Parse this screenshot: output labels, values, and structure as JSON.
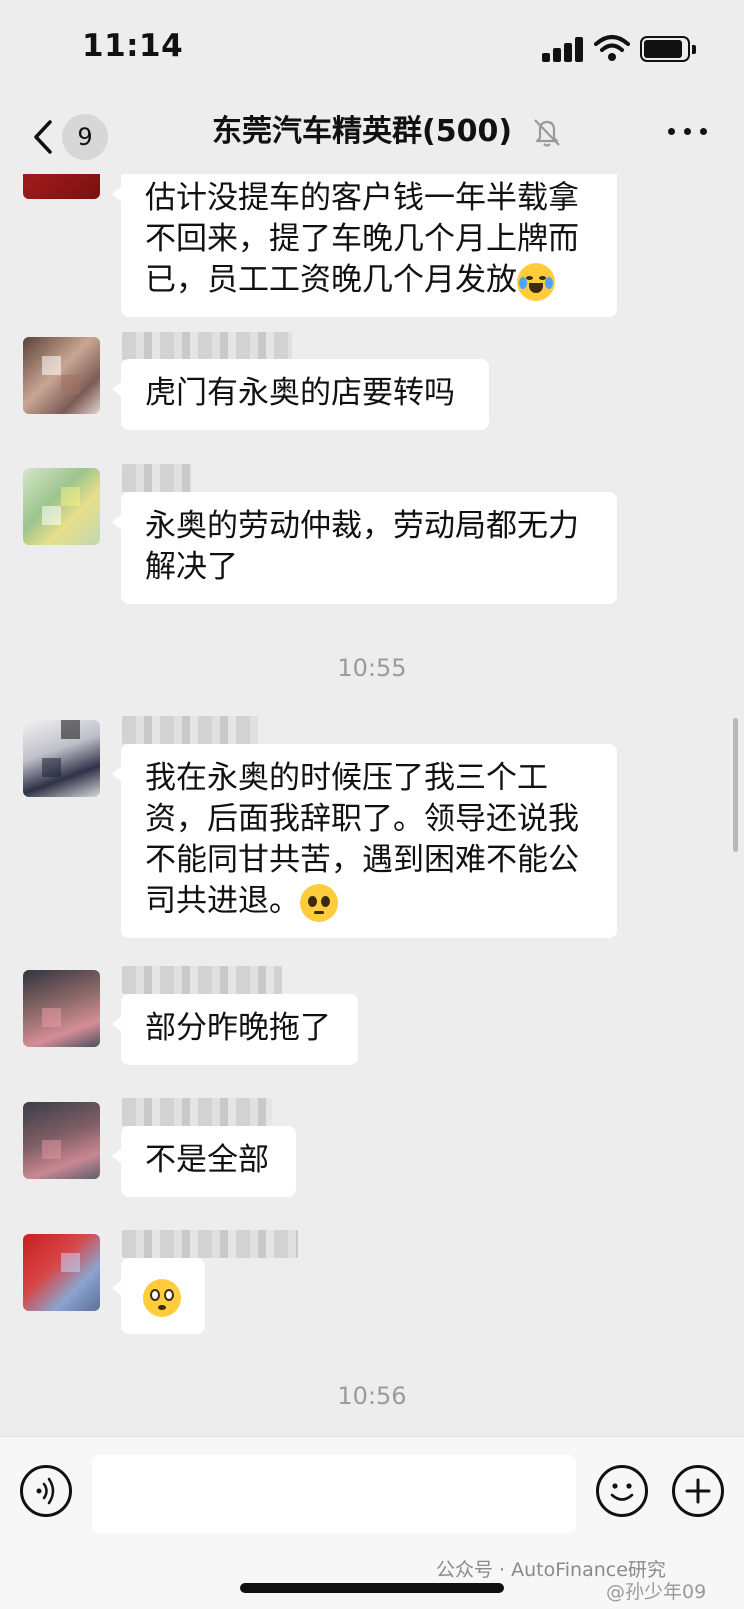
{
  "status_bar": {
    "time": "11:14"
  },
  "nav": {
    "unread_count": "9",
    "title": "东莞汽车精英群(500)"
  },
  "messages": [
    {
      "text": "估计没提车的客户钱一年半载拿\n不回来，提了车晚几个月上牌而\n已，员工工资晚几个月发放",
      "emoji": "laughing-crying-emoji"
    },
    {
      "text": "虎门有永奥的店要转吗"
    },
    {
      "text": "永奥的劳动仲裁，劳动局都无力\n解决了"
    },
    {
      "text": "我在永奥的时候压了我三个工\n资，后面我辞职了。领导还说我\n不能同甘共苦，遇到困难不能公\n司共进退。",
      "emoji": "pleading-emoji"
    },
    {
      "text": "部分昨晚拖了"
    },
    {
      "text": "不是全部"
    },
    {
      "text": "",
      "emoji": "flushed-emoji"
    }
  ],
  "timestamps": [
    "10:55",
    "10:56"
  ],
  "footer": {
    "watermark": "公众号 · AutoFinance研究",
    "watermark_2": "@孙少年09"
  },
  "colors": {
    "background": "#ededed",
    "bubble": "#ffffff",
    "input_bar": "#f7f7f7"
  }
}
